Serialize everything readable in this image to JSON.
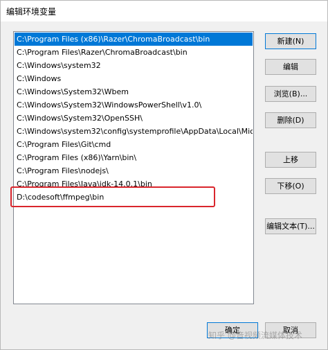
{
  "window": {
    "title": "编辑环境变量"
  },
  "path_list": {
    "items": [
      "C:\\Program Files (x86)\\Razer\\ChromaBroadcast\\bin",
      "C:\\Program Files\\Razer\\ChromaBroadcast\\bin",
      "C:\\Windows\\system32",
      "C:\\Windows",
      "C:\\Windows\\System32\\Wbem",
      "C:\\Windows\\System32\\WindowsPowerShell\\v1.0\\",
      "C:\\Windows\\System32\\OpenSSH\\",
      "C:\\Windows\\system32\\config\\systemprofile\\AppData\\Local\\Mic...",
      "C:\\Program Files\\Git\\cmd",
      "C:\\Program Files (x86)\\Yarn\\bin\\",
      "C:\\Program Files\\nodejs\\",
      "C:\\Program Files\\Java\\jdk-14.0.1\\bin",
      "D:\\codesoft\\ffmpeg\\bin"
    ],
    "selected_index": 0,
    "highlighted_index": 12
  },
  "buttons": {
    "new": "新建(N)",
    "edit": "编辑",
    "browse": "浏览(B)...",
    "delete": "删除(D)",
    "move_up": "上移",
    "move_down": "下移(O)",
    "edit_text": "编辑文本(T)...",
    "ok": "确定",
    "cancel": "取消"
  },
  "watermark": "知乎 @音视频流媒体技术",
  "colors": {
    "selection": "#0078d7",
    "highlight_outline": "#d9252c"
  }
}
